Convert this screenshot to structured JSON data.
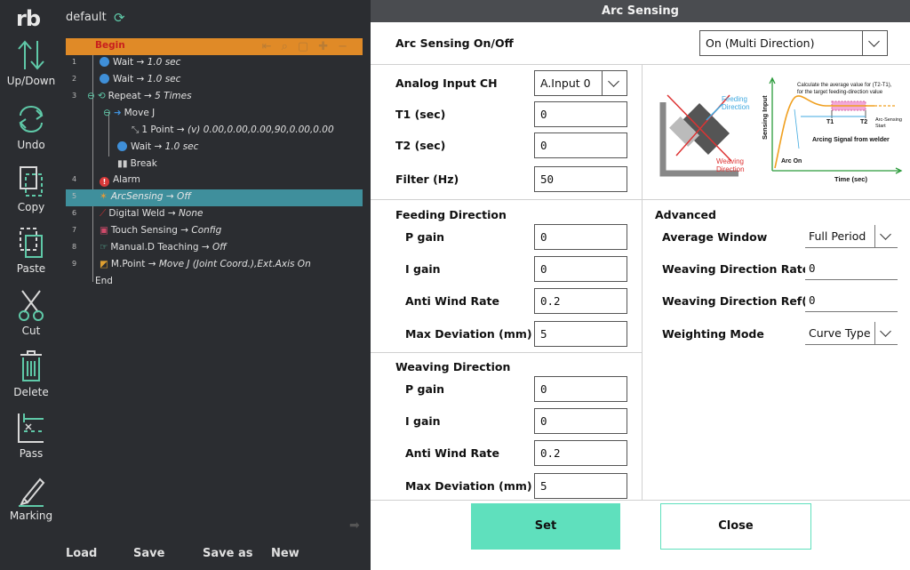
{
  "app": {
    "logo": "rb",
    "program_name": "default"
  },
  "toolbar": {
    "up_down": "Up/Down",
    "undo": "Undo",
    "copy": "Copy",
    "paste": "Paste",
    "cut": "Cut",
    "delete": "Delete",
    "pass": "Pass",
    "marking": "Marking"
  },
  "tree": {
    "begin": "Begin",
    "end": "End",
    "rows": [
      {
        "ln": "1",
        "label": "Wait",
        "value": "→ 1.0 sec"
      },
      {
        "ln": "2",
        "label": "Wait",
        "value": "→ 1.0 sec"
      },
      {
        "ln": "3",
        "label": "Repeat",
        "value": "→ 5 Times"
      },
      {
        "ln": "",
        "label": "Move J",
        "value": ""
      },
      {
        "ln": "",
        "label": "1 Point",
        "value": "→ (v) 0.00,0.00,0.00,90,0.00,0.00"
      },
      {
        "ln": "",
        "label": "Wait",
        "value": "→ 1.0 sec"
      },
      {
        "ln": "",
        "label": "Break",
        "value": ""
      },
      {
        "ln": "4",
        "label": "Alarm",
        "value": ""
      },
      {
        "ln": "5",
        "label": "ArcSensing",
        "value": "→ Off"
      },
      {
        "ln": "6",
        "label": "Digital Weld",
        "value": "→ None"
      },
      {
        "ln": "7",
        "label": "Touch Sensing",
        "value": "→ Config"
      },
      {
        "ln": "8",
        "label": "Manual.D Teaching",
        "value": "→ Off"
      },
      {
        "ln": "9",
        "label": "M.Point",
        "value": "→ Move J (Joint Coord.),Ext.Axis On"
      }
    ]
  },
  "bottom_nav": {
    "load": "Load",
    "save": "Save",
    "save_as": "Save as",
    "new": "New"
  },
  "dialog": {
    "title": "Arc Sensing",
    "onoff_label": "Arc Sensing On/Off",
    "onoff_value": "On (Multi Direction)",
    "analog_label": "Analog Input CH",
    "analog_value": "A.Input 0",
    "t1_label": "T1 (sec)",
    "t1_value": "0",
    "t2_label": "T2 (sec)",
    "t2_value": "0",
    "filter_label": "Filter (Hz)",
    "filter_value": "50",
    "feeding": {
      "title": "Feeding Direction",
      "p_label": "P gain",
      "p_value": "0",
      "i_label": "I gain",
      "i_value": "0",
      "awr_label": "Anti Wind Rate",
      "awr_value": "0.2",
      "md_label": "Max Deviation (mm)",
      "md_value": "5"
    },
    "weaving": {
      "title": "Weaving Direction",
      "p_label": "P gain",
      "p_value": "0",
      "i_label": "I gain",
      "i_value": "0",
      "awr_label": "Anti Wind Rate",
      "awr_value": "0.2",
      "md_label": "Max Deviation (mm)",
      "md_value": "5"
    },
    "advanced": {
      "title": "Advanced",
      "avg_label": "Average Window",
      "avg_value": "Full Period",
      "wdr_label": "Weaving Direction Rate",
      "wdr_value": "0",
      "wdref_label": "Weaving Direction Ref(A)",
      "wdref_value": "0",
      "wm_label": "Weighting Mode",
      "wm_value": "Curve Type"
    },
    "diagram": {
      "feeding": [
        "Feeding",
        "Direction"
      ],
      "weaving": [
        "Weaving",
        "Direction"
      ],
      "calc": [
        "Calculate the average value for (T2-T1),",
        "for the target feeding-direction value"
      ],
      "t1": "T1",
      "t2": "T2",
      "arc_sensing": [
        "Arc-Sensing",
        "Start"
      ],
      "arcing_signal": "Arcing Signal from welder",
      "arc_on": "Arc On",
      "sensing_input": "Sensing Input",
      "time": "Time (sec)"
    },
    "set": "Set",
    "close": "Close"
  },
  "colors": {
    "accent": "#5fe0bd",
    "selected_row": "#3f8f9c",
    "begin_row": "#e08a27"
  }
}
